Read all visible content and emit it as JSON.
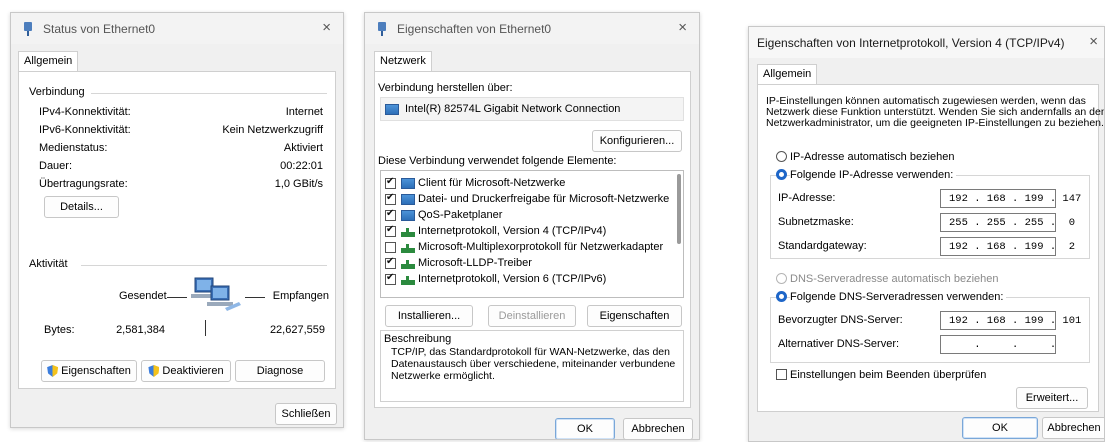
{
  "status_window": {
    "title": "Status von Ethernet0",
    "tab": "Allgemein",
    "verbindung_header": "Verbindung",
    "rows": [
      {
        "label": "IPv4-Konnektivität:",
        "value": "Internet"
      },
      {
        "label": "IPv6-Konnektivität:",
        "value": "Kein Netzwerkzugriff"
      },
      {
        "label": "Medienstatus:",
        "value": "Aktiviert"
      },
      {
        "label": "Dauer:",
        "value": "00:22:01"
      },
      {
        "label": "Übertragungsrate:",
        "value": "1,0 GBit/s"
      }
    ],
    "details_button": "Details...",
    "aktivitaet_header": "Aktivität",
    "sent_label": "Gesendet",
    "received_label": "Empfangen",
    "bytes_label": "Bytes:",
    "bytes_sent": "2,581,384",
    "bytes_received": "22,627,559",
    "buttons": {
      "properties": "Eigenschaften",
      "disable": "Deaktivieren",
      "diagnose": "Diagnose",
      "close": "Schließen"
    }
  },
  "properties_window": {
    "title": "Eigenschaften von Ethernet0",
    "tab": "Netzwerk",
    "connect_label": "Verbindung herstellen über:",
    "adapter": "Intel(R) 82574L Gigabit Network Connection",
    "configure_button": "Konfigurieren...",
    "elements_label": "Diese Verbindung verwendet folgende Elemente:",
    "items": [
      {
        "label": "Client für Microsoft-Netzwerke",
        "checked": true,
        "icon": "client-icon"
      },
      {
        "label": "Datei- und Druckerfreigabe für Microsoft-Netzwerke",
        "checked": true,
        "icon": "client-icon"
      },
      {
        "label": "QoS-Paketplaner",
        "checked": true,
        "icon": "client-icon"
      },
      {
        "label": "Internetprotokoll, Version 4 (TCP/IPv4)",
        "checked": true,
        "icon": "protocol-icon"
      },
      {
        "label": "Microsoft-Multiplexorprotokoll für Netzwerkadapter",
        "checked": false,
        "icon": "protocol-icon"
      },
      {
        "label": "Microsoft-LLDP-Treiber",
        "checked": true,
        "icon": "protocol-icon"
      },
      {
        "label": "Internetprotokoll, Version 6 (TCP/IPv6)",
        "checked": true,
        "icon": "protocol-icon"
      }
    ],
    "install_button": "Installieren...",
    "uninstall_button": "Deinstallieren",
    "properties_button": "Eigenschaften",
    "description_header": "Beschreibung",
    "description_lines": [
      "TCP/IP, das Standardprotokoll für WAN-Netzwerke, das den",
      "Datenaustausch über verschiedene, miteinander verbundene",
      "Netzwerke ermöglicht."
    ],
    "ok_button": "OK",
    "cancel_button": "Abbrechen"
  },
  "ipv4_window": {
    "title": "Eigenschaften von Internetprotokoll, Version 4 (TCP/IPv4)",
    "close_glyph": "×",
    "tab": "Allgemein",
    "intro_lines": [
      "IP-Einstellungen können automatisch zugewiesen werden, wenn das",
      "Netzwerk diese Funktion unterstützt. Wenden Sie sich andernfalls an den",
      "Netzwerkadministrator, um die geeigneten IP-Einstellungen zu beziehen."
    ],
    "radio_auto_ip": "IP-Adresse automatisch beziehen",
    "radio_manual_ip": "Folgende IP-Adresse verwenden:",
    "ip_label": "IP-Adresse:",
    "ip_value": "192 . 168 . 199 . 147",
    "mask_label": "Subnetzmaske:",
    "mask_value": "255 . 255 . 255 .  0",
    "gateway_label": "Standardgateway:",
    "gateway_value": "192 . 168 . 199 .  2",
    "radio_auto_dns": "DNS-Serveradresse automatisch beziehen",
    "radio_manual_dns": "Folgende DNS-Serveradressen verwenden:",
    "dns1_label": "Bevorzugter DNS-Server:",
    "dns1_value": "192 . 168 . 199 . 101",
    "dns2_label": "Alternativer DNS-Server:",
    "dns2_value": "    .     .     .",
    "validate_label": "Einstellungen beim Beenden überprüfen",
    "advanced_button": "Erweitert...",
    "ok_button": "OK",
    "cancel_button": "Abbrechen"
  }
}
